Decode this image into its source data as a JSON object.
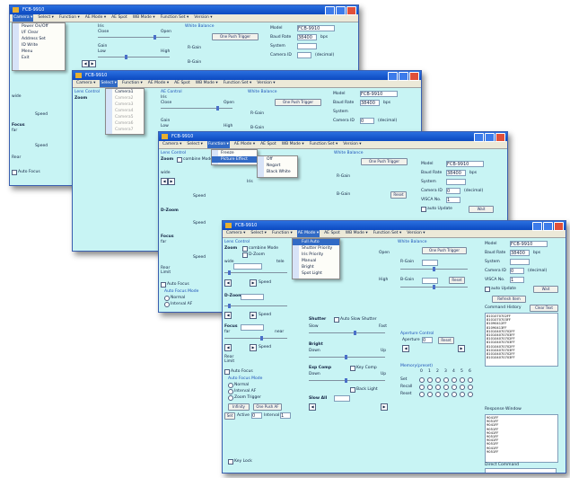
{
  "app": {
    "title": "FCB-9910"
  },
  "menu": {
    "items": [
      "Camera ▾",
      "Select ▾",
      "Function ▾",
      "AE Mode ▾",
      "AE Spot",
      "WB Mode ▾",
      "Function Set ▾",
      "Version ▾"
    ]
  },
  "camera_menu": {
    "items": [
      "Power On/Off",
      "I/F Clear",
      "Address Set",
      "ID Write",
      "Menu",
      "Exit"
    ]
  },
  "select_menu": {
    "items": [
      "Camera1",
      "Camera2",
      "Camera3",
      "Camera4",
      "Camera5",
      "Camera6",
      "Camera7"
    ]
  },
  "function_menu": {
    "items": [
      "Freeze",
      "Picture Effect"
    ]
  },
  "effect_submenu": {
    "items": [
      "Off",
      "Negart",
      "Black White"
    ]
  },
  "ae_menu": {
    "items": [
      "Full Auto",
      "Shutter Priority",
      "Iris Priority",
      "Manual",
      "Bright",
      "Spot Light"
    ]
  },
  "lens": {
    "group": "Lens Control",
    "zoom_label": "Zoom",
    "combine_mode": "combine Mode",
    "dzoom": "D-Zoom",
    "wide": "wide",
    "tele": "tele",
    "speed": "Speed",
    "focus": "Focus",
    "far": "far",
    "near": "near",
    "rear": "Rear",
    "limit": "Limit",
    "auto_focus": "Auto Focus",
    "af_mode": "Auto Focus Mode",
    "normal": "Normal",
    "interval_af": "Interval AF",
    "zoom_trigger": "Zoom Trigger",
    "infinity": "Infinity",
    "one_push": "One Push AF",
    "set": "Set",
    "active": "Active",
    "active_val": "0",
    "interval": "Interval",
    "interval_val": "1",
    "key_lock": "Key Lock"
  },
  "ae": {
    "group": "AE Control",
    "iris": "Iris",
    "close": "Close",
    "open": "Open",
    "gain": "Gain",
    "low": "Low",
    "high": "High",
    "shutter": "Shutter",
    "auto_slow": "Auto Slow Shutter",
    "slow": "Slow",
    "fast": "Fast",
    "bright": "Bright",
    "down": "Down",
    "up": "Up",
    "exp_comp": "Exp Comp",
    "key_comp": "Key Comp",
    "back_light": "Back Light",
    "slow_all": "Slow All"
  },
  "wb": {
    "group": "White Balance",
    "one_push": "One Push Trigger",
    "r_gain": "R-Gain",
    "b_gain": "B-Gain",
    "reset": "Reset",
    "aperture": "Aperture Control",
    "aperture_lbl": "Aperture",
    "aperture_val": "0"
  },
  "memory": {
    "group": "Memory(preset)",
    "numbers": [
      "0",
      "1",
      "2",
      "3",
      "4",
      "5",
      "6"
    ],
    "rows": [
      "Set",
      "Recall",
      "Reset"
    ]
  },
  "settings": {
    "model_label": "Model",
    "model": "FCB-9910",
    "baud_label": "Baud Rate",
    "baud": "38400",
    "bps": "bps",
    "system_label": "System",
    "camera_id_label": "Camera ID",
    "camera_id": "0",
    "decimal": "(decimal)",
    "visca_label": "VISCA No.",
    "visca": "1",
    "auto_update": "auto Update",
    "wait": "Wait",
    "refresh": "Refresh Item"
  },
  "history": {
    "label": "Command History",
    "clear": "Clear Text",
    "lines": [
      "8101070702FF",
      "8101070703FF",
      "81090412FF",
      "81090413FF",
      "810104070702FF",
      "810104070703FF",
      "810104070702FF",
      "810104070703FF",
      "810104070702FF",
      "810104070703FF",
      "810104070702FF",
      "810104070703FF"
    ]
  },
  "response": {
    "label": "Response Window",
    "lines": [
      "9041FF",
      "9051FF",
      "9041FF",
      "9051FF",
      "9041FF",
      "9051FF",
      "9041FF",
      "9051FF",
      "9041FF",
      "9051FF"
    ]
  },
  "direct": {
    "label": "Direct Command"
  }
}
